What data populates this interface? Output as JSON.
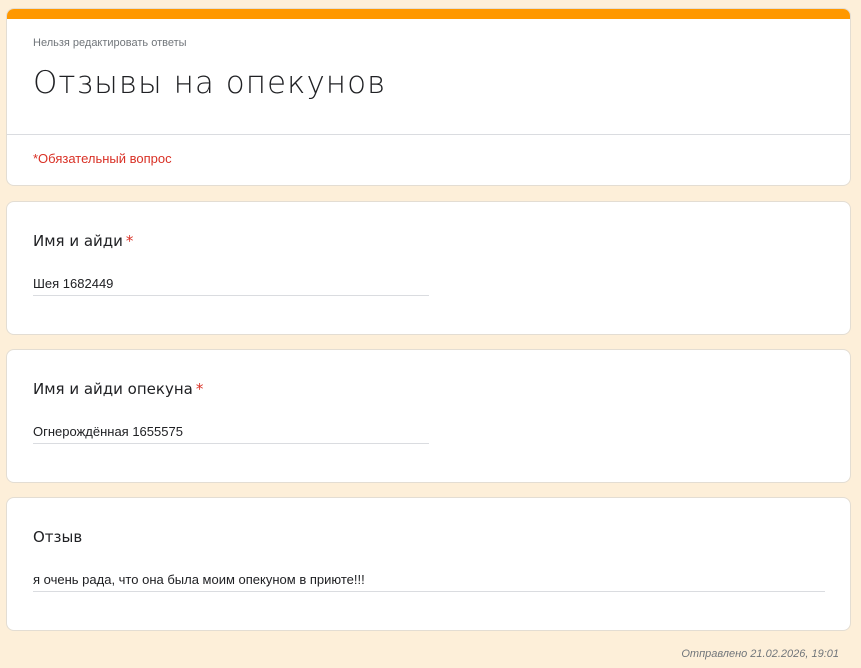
{
  "header": {
    "no_edit_text": "Нельзя редактировать ответы",
    "title": "Отзывы на опекунов",
    "required_note": "*Обязательный вопрос",
    "accent_color": "#ff9800"
  },
  "questions": [
    {
      "label": "Имя и айди",
      "required_mark": "*",
      "answer": "Шея 1682449"
    },
    {
      "label": "Имя и айди опекуна",
      "required_mark": "*",
      "answer": "Огнерождённая 1655575"
    },
    {
      "label": "Отзыв",
      "answer": "я очень рада, что она была моим опекуном в приюте!!!"
    }
  ],
  "footer": {
    "submitted": "Отправлено 21.02.2026, 19:01"
  }
}
